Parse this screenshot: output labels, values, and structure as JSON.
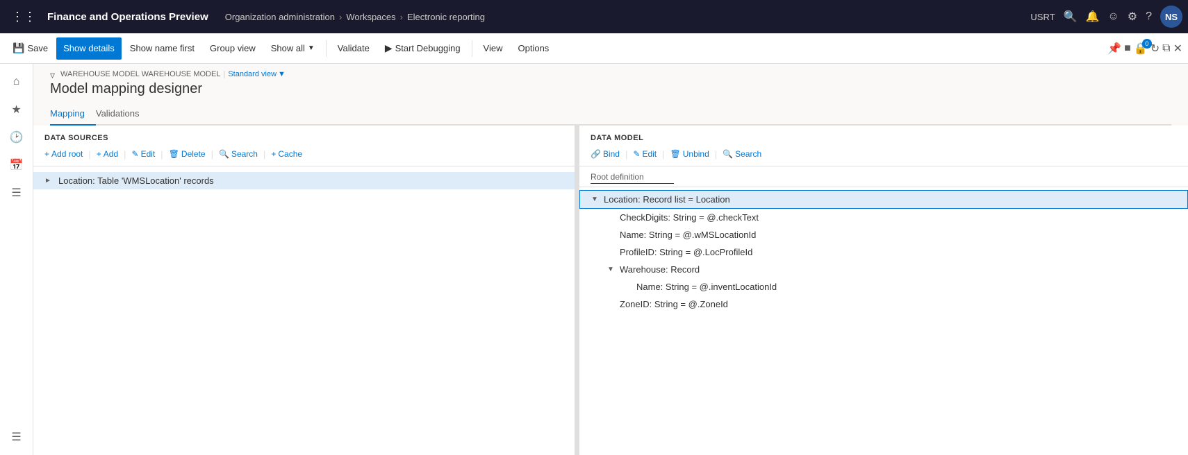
{
  "topbar": {
    "app_title": "Finance and Operations Preview",
    "breadcrumb": [
      "Organization administration",
      "Workspaces",
      "Electronic reporting"
    ],
    "user": "USRT",
    "avatar": "NS"
  },
  "toolbar": {
    "save_label": "Save",
    "show_details_label": "Show details",
    "show_name_first_label": "Show name first",
    "group_view_label": "Group view",
    "show_all_label": "Show all",
    "validate_label": "Validate",
    "start_debugging_label": "Start Debugging",
    "view_label": "View",
    "options_label": "Options"
  },
  "page": {
    "breadcrumb1": "WAREHOUSE MODEL WAREHOUSE MODEL",
    "breadcrumb2": "Standard view",
    "title": "Model mapping designer",
    "tab_mapping": "Mapping",
    "tab_validations": "Validations"
  },
  "datasources": {
    "pane_title": "DATA SOURCES",
    "add_root_label": "Add root",
    "add_label": "Add",
    "edit_label": "Edit",
    "delete_label": "Delete",
    "search_label": "Search",
    "cache_label": "Cache",
    "tree_item": "Location: Table 'WMSLocation' records"
  },
  "datamodel": {
    "pane_title": "DATA MODEL",
    "bind_label": "Bind",
    "edit_label": "Edit",
    "unbind_label": "Unbind",
    "search_label": "Search",
    "root_def": "Root definition",
    "items": [
      {
        "id": 0,
        "label": "Location: Record list = Location",
        "indent": 0,
        "chevron": "▲",
        "selected": true
      },
      {
        "id": 1,
        "label": "CheckDigits: String = @.checkText",
        "indent": 1,
        "chevron": "",
        "selected": false
      },
      {
        "id": 2,
        "label": "Name: String = @.wMSLocationId",
        "indent": 1,
        "chevron": "",
        "selected": false
      },
      {
        "id": 3,
        "label": "ProfileID: String = @.LocProfileId",
        "indent": 1,
        "chevron": "",
        "selected": false
      },
      {
        "id": 4,
        "label": "Warehouse: Record",
        "indent": 1,
        "chevron": "▲",
        "selected": false
      },
      {
        "id": 5,
        "label": "Name: String = @.inventLocationId",
        "indent": 2,
        "chevron": "",
        "selected": false
      },
      {
        "id": 6,
        "label": "ZoneID: String = @.ZoneId",
        "indent": 1,
        "chevron": "",
        "selected": false
      }
    ]
  }
}
